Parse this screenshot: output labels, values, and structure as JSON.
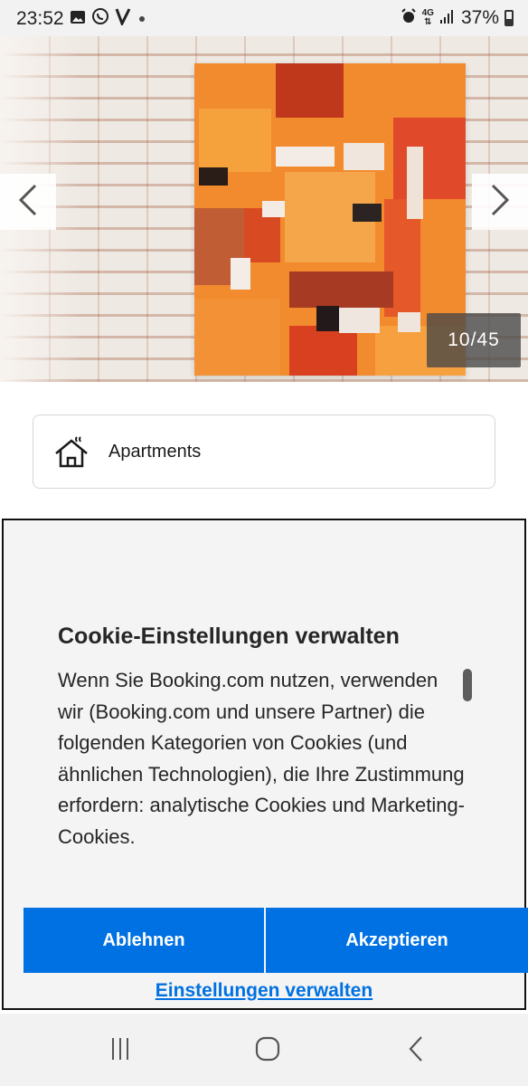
{
  "status_bar": {
    "time": "23:52",
    "network": "4G",
    "battery": "37%",
    "left_icons": [
      "gallery-icon",
      "viber-icon",
      "v-app-icon",
      "dot-icon"
    ],
    "right_icons": [
      "alarm-icon",
      "network-4g-icon",
      "signal-icon",
      "battery-icon"
    ]
  },
  "gallery": {
    "counter": "10/45",
    "current": 10,
    "total": 45,
    "prev_icon": "chevron-left-icon",
    "next_icon": "chevron-right-icon"
  },
  "property": {
    "type_label": "Apartments",
    "type_icon": "house-icon"
  },
  "cookie_dialog": {
    "title": "Cookie-Einstellungen verwalten",
    "body": "Wenn Sie Booking.com nutzen, verwenden wir (Booking.com und unsere Partner) die folgenden Kategorien von Cookies (und ähnlichen Technologien), die Ihre Zustimmung erfordern: analytische Cookies und Marketing-Cookies.",
    "reject_label": "Ablehnen",
    "accept_label": "Akzeptieren",
    "manage_label": "Einstellungen verwalten"
  },
  "nav_bar": {
    "icons": [
      "recents-icon",
      "home-icon",
      "back-icon"
    ]
  },
  "colors": {
    "accent": "#0071e2",
    "dialog_bg": "#f4f4f4",
    "status_bar_bg": "#f2f2f2"
  }
}
